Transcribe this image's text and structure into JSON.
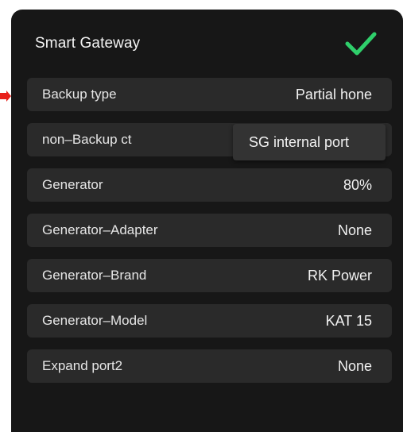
{
  "colors": {
    "card_background": "#171717",
    "row_background": "#2a2a2a",
    "accent_check": "#2fcf6b",
    "marker": "#e8201a"
  },
  "header": {
    "title": "Smart Gateway",
    "confirm_icon": "checkmark-icon"
  },
  "rows": [
    {
      "label": "Backup type",
      "value": "Partial hone"
    },
    {
      "label": "non–Backup ct",
      "value": "SG internal port"
    },
    {
      "label": "Generator",
      "value": "80%"
    },
    {
      "label": "Generator–Adapter",
      "value": "None"
    },
    {
      "label": "Generator–Brand",
      "value": "RK Power"
    },
    {
      "label": "Generator–Model",
      "value": "KAT 15"
    },
    {
      "label": "Expand port2",
      "value": "None"
    }
  ]
}
